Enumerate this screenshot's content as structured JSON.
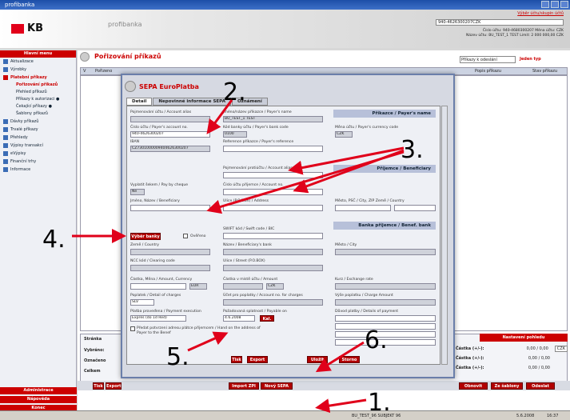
{
  "window": {
    "title": "profibanka"
  },
  "header": {
    "brand": "KB",
    "app": "profibanka",
    "user_info": "Výběr účtu/skupin účtů",
    "account": "940-4626300207CZK",
    "line1": "Číslo účtu: 940-4680300207   Měna účtu: CZK",
    "line2": "Název účtu: BU_TEST_1 TEST   Limit: 2 000 000,00 CZK"
  },
  "sidebar": {
    "head": "Hlavní menu",
    "items": [
      {
        "label": "Aktualizace"
      },
      {
        "label": "Výrobky"
      },
      {
        "label": "Platební příkazy",
        "active": true
      }
    ],
    "subitems": [
      "Pořizování příkazů",
      "Přehled příkazů",
      "Příkazy k autorizaci ●",
      "Čekající příkazy ●",
      "Šablony příkazů"
    ],
    "items2": [
      "Dávky příkazů",
      "Trvalé příkazy",
      "Přehledy",
      "Výpisy transakcí",
      "eVýpisy",
      "Finanční trhy",
      "Informace"
    ],
    "bottom": [
      "Administrace",
      "Nápověda",
      "Konec"
    ]
  },
  "main": {
    "title": "Pořizování příkazů",
    "filter": "Příkazy k odeslání",
    "filter_link": "Jeden typ",
    "col_v": "V",
    "col_date": "Pořizeno",
    "col_type": "Popis příkazu",
    "col_state": "Stav příkazu"
  },
  "dialog": {
    "title": "SEPA EuroPlatba",
    "tabs": [
      "Detail",
      "Nepovinné informace SEPA",
      "Oznámení"
    ],
    "payer": {
      "section": "Příkazce / Payer's name",
      "acc_name_label": "Pojmenování účtu / Account alias",
      "name_label": "Jméno/název příkazce / Payer's name",
      "name_value": "BU_TEST_1          TEST",
      "account_label": "Číslo účtu / Payer's account no.",
      "account_value": "940-4626300207",
      "bank_label": "Kód banky účtu / Payer's bank code",
      "bank_value": "0100",
      "currency_label": "Měna účtu / Payer's currency code",
      "currency_value": "CZK",
      "iban_label": "IBAN",
      "iban_value": "CZ7301000009404626300207",
      "ref_label": "Reference příkazce / Payer's reference"
    },
    "beneficiary": {
      "section": "Příjemce / Beneficiary",
      "alias_label": "Pojmenování protiúčtu / Account alias",
      "cheque_label": "Vyplatit šekem / Pay by cheque",
      "cheque_value": "Ne",
      "account_label": "Číslo účtu příjemce / Account no.",
      "name_label": "Jméno, Název / Beneficiary",
      "address_label": "Ulice (P.O.BOX) / Address",
      "city_label": "Město, PSČ / City, ZIP Země / Country"
    },
    "bank": {
      "section": "Banka příjemce / Benef. bank",
      "select_button": "Výběr banky",
      "verified": "Ověřeno",
      "swift_label": "SWIFT kód / Swift code / BIC",
      "country_label": "Země / Country",
      "bankname_label": "Název / Beneficiary's bank",
      "city_label": "Město / City",
      "ncc_label": "NCC kód / Clearing code",
      "street_label": "Ulice / Street (P.O.BOX)"
    },
    "amount": {
      "amount_label": "Částka, Měna / Amount, Currency",
      "currency_value": "EUR",
      "local_label": "Částka v místě účtu / Amount",
      "local_currency": "CZK",
      "rate_label": "Kurz / Exchange rate",
      "charges_label": "Poplatek / Detail of charges",
      "charges_value": "SLV",
      "charges_acc_label": "Účet pro poplatky / Account no. for charges",
      "charges_amount_label": "Výše poplatku / Charge Amount",
      "exec_label": "Platba proveďena / Payment execution",
      "exec_value": "Expres (do 1d Red)",
      "date_label": "Požadovaná splatnost / Payable on",
      "date_value": "4.6.2008",
      "cal_button": "Kal.",
      "reason_label": "Důvod platby / Details of payment",
      "forward_label": "Předat potvrzení adresu plátce příjemcem / Hand on the address of Payer to the Benef"
    },
    "buttons": {
      "print": "Tisk",
      "export": "Export",
      "save": "Uložit",
      "cancel": "Storno"
    }
  },
  "summary": {
    "labels": [
      "Stránka",
      "Vybráno:",
      "Označeno",
      "Celkem"
    ],
    "right_head": "Nastavení pohledu",
    "right_rows": [
      {
        "label": "Částka (+/-):",
        "value": "0,00 / 0,00",
        "currency": "CZK"
      },
      {
        "label": "Částka (+/-):",
        "value": "0,00 / 0,00"
      },
      {
        "label": "Částka (+/-):",
        "value": "0,00 / 0,00"
      }
    ]
  },
  "bottom": {
    "print": "Tisk",
    "export": "Export",
    "import": "Import ZPI",
    "new": "Nový SEPA",
    "refresh": "Obnovit",
    "templates": "Ze šablony",
    "send": "Odeslat"
  },
  "statusbar": {
    "text": "BU_TEST_96 SUBJEKT 96",
    "date": "5.6.2008",
    "time": "16:37"
  },
  "annotations": [
    "1.",
    "2.",
    "3.",
    "4.",
    "5.",
    "6."
  ]
}
